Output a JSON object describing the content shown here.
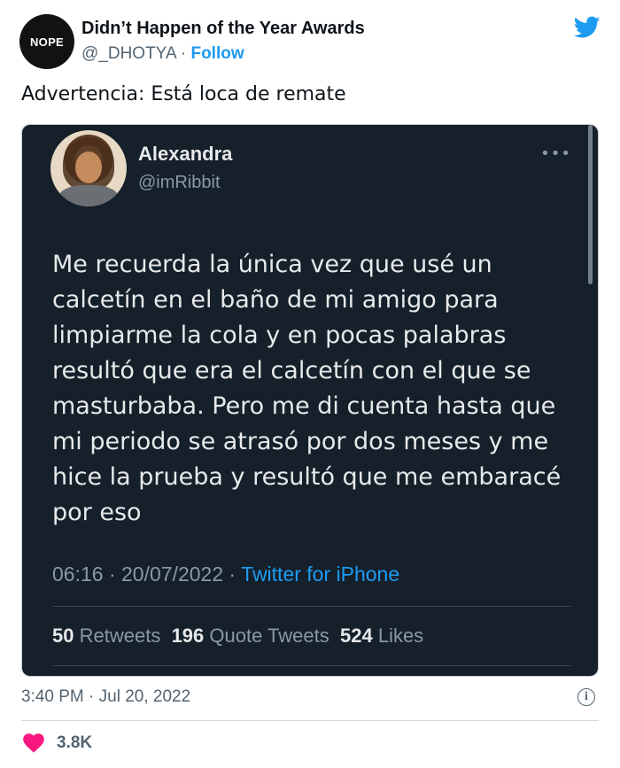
{
  "author": {
    "avatar_text": "NOPE",
    "name": "Didn’t Happen of the Year Awards",
    "handle": "@_DHOTYA",
    "separator": " · ",
    "follow_label": "Follow"
  },
  "brand_icon": "twitter-bird-icon",
  "tweet": {
    "text": "Advertencia: Está loca de remate",
    "timestamp": "3:40 PM · Jul 20, 2022",
    "likes": "3.8K"
  },
  "embedded": {
    "name": "Alexandra",
    "handle": "@imRibbit",
    "more_label": "•••",
    "lines": [
      "Me recuerda la única vez que usé un",
      "calcetín en el baño de mi amigo para",
      "limpiarme la cola y en pocas palabras",
      "resultó que era el calcetín con el que se",
      "masturbaba. Pero me di cuenta hasta que",
      "mi periodo se atrasó por dos meses y me",
      "hice la prueba y resultó que me embaracé",
      "por eso"
    ],
    "meta": {
      "time": "06:16",
      "date": "20/07/2022",
      "separator": " · ",
      "source": "Twitter for iPhone"
    },
    "stats": {
      "retweets_count": "50",
      "retweets_label": "Retweets",
      "quotes_count": "196",
      "quotes_label": "Quote Tweets",
      "likes_count": "524",
      "likes_label": "Likes"
    }
  },
  "colors": {
    "brand_blue": "#1d9bf0",
    "embed_background": "#15202b",
    "heart": "#f91880"
  }
}
